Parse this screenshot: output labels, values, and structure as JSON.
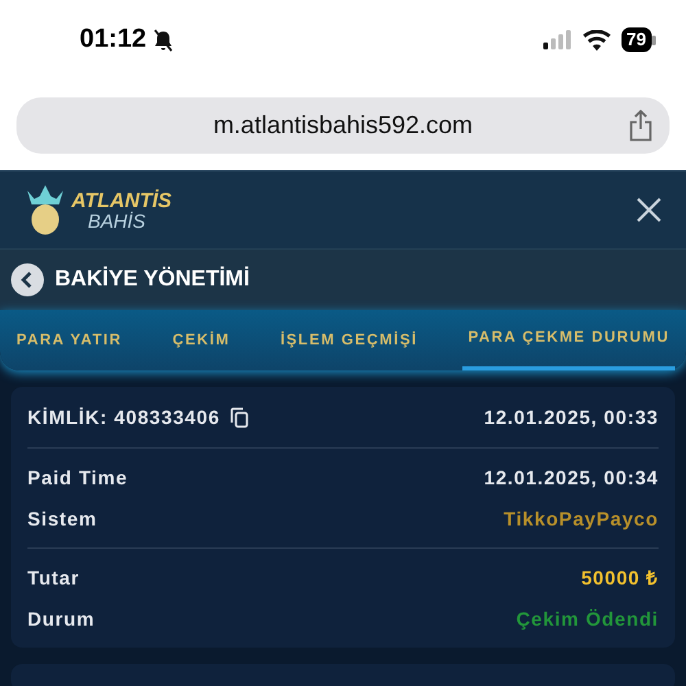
{
  "status_bar": {
    "time": "01:12",
    "muted": true,
    "battery": "79"
  },
  "browser": {
    "url": "m.atlantisbahis592.com"
  },
  "header": {
    "logo_top": "ATLANTİS",
    "logo_bottom": "BAHİS"
  },
  "page_title": "BAKİYE YÖNETİMİ",
  "tabs": [
    {
      "label": "PARA YATIR",
      "selected": false
    },
    {
      "label": "ÇEKİM",
      "selected": false
    },
    {
      "label": "İŞLEM GEÇMİŞİ",
      "selected": false
    },
    {
      "label": "PARA ÇEKME DURUMU",
      "selected": true
    }
  ],
  "card": {
    "id_label": "KİMLİK:",
    "id": "408333406",
    "created": "12.01.2025, 00:33",
    "sections": [
      [
        {
          "label": "Paid Time",
          "value": "12.01.2025, 00:34",
          "color": "#e6e9ee"
        },
        {
          "label": "Sistem",
          "value": "TikkoPayPayco",
          "color": "#b8902a"
        }
      ],
      [
        {
          "label": "Tutar",
          "value": "50000 ₺",
          "color": "#f2c12e"
        },
        {
          "label": "Durum",
          "value": "Çekim Ödendi",
          "color": "#22963a"
        }
      ]
    ]
  }
}
